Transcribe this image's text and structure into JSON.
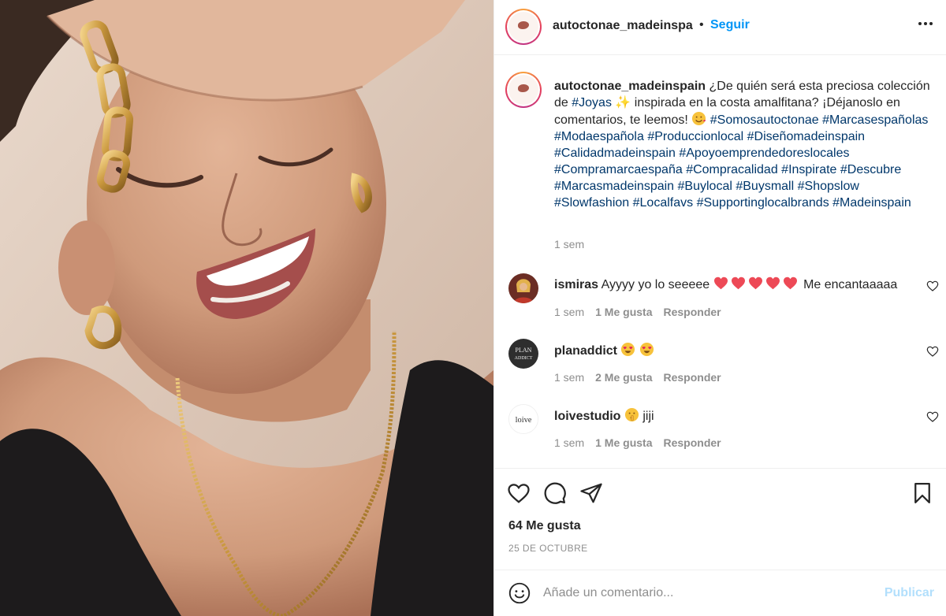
{
  "post": {
    "username_header": "autoctonae_madeinspa",
    "separator": "•",
    "follow_label": "Seguir",
    "caption": {
      "username": "autoctonae_madeinspain",
      "text_1": "¿De quién será esta preciosa colección de",
      "tag_joyas": "#Joyas",
      "sparkles": "✨",
      "text_2": "inspirada en la costa amalfitana? ¡Déjanoslo en comentarios, te leemos!",
      "hashtags": [
        "#Somosautoctonae",
        "#Marcasespañolas",
        "#Modaespañola",
        "#Produccionlocal",
        "#Diseñomadeinspain",
        "#Calidadmadeinspain",
        "#Apoyoemprendedoreslocales",
        "#Compramarcaespaña",
        "#Compracalidad",
        "#Inspirate",
        "#Descubre",
        "#Marcasmadeinspain",
        "#Buylocal",
        "#Buysmall",
        "#Shopslow",
        "#Slowfashion",
        "#Localfavs",
        "#Supportinglocalbrands",
        "#Madeinspain"
      ],
      "time": "1 sem"
    },
    "comments": [
      {
        "username": "ismiras",
        "text_pre": "Ayyyy yo lo seeeee",
        "text_post": "Me encantaaaaa",
        "time": "1 sem",
        "likes": "1 Me gusta",
        "reply": "Responder",
        "heart_count": 5
      },
      {
        "username": "planaddict",
        "text_pre": "",
        "text_post": "",
        "time": "1 sem",
        "likes": "2 Me gusta",
        "reply": "Responder",
        "emoji": "heart-eyes"
      },
      {
        "username": "loivestudio",
        "text_pre": "",
        "text_post": "jiji",
        "time": "1 sem",
        "likes": "1 Me gusta",
        "reply": "Responder",
        "emoji": "shush-face"
      }
    ],
    "avatars": {
      "planaddict_text_1": "PLAN",
      "planaddict_text_2": "ADDICT",
      "loivestudio_text": "loive"
    },
    "likes_count": "64 Me gusta",
    "date": "25 DE OCTUBRE",
    "add_comment": {
      "placeholder": "Añade un comentario...",
      "publish_label": "Publicar"
    },
    "colors": {
      "link": "#0095f6",
      "hashtag": "#00376b",
      "muted": "#8e8e8e",
      "publish_disabled": "#b2dffc",
      "heart": "#ed4956"
    },
    "icons": [
      "more-options-icon",
      "like-icon",
      "comment-icon",
      "share-icon",
      "save-icon",
      "emoji-icon"
    ]
  }
}
